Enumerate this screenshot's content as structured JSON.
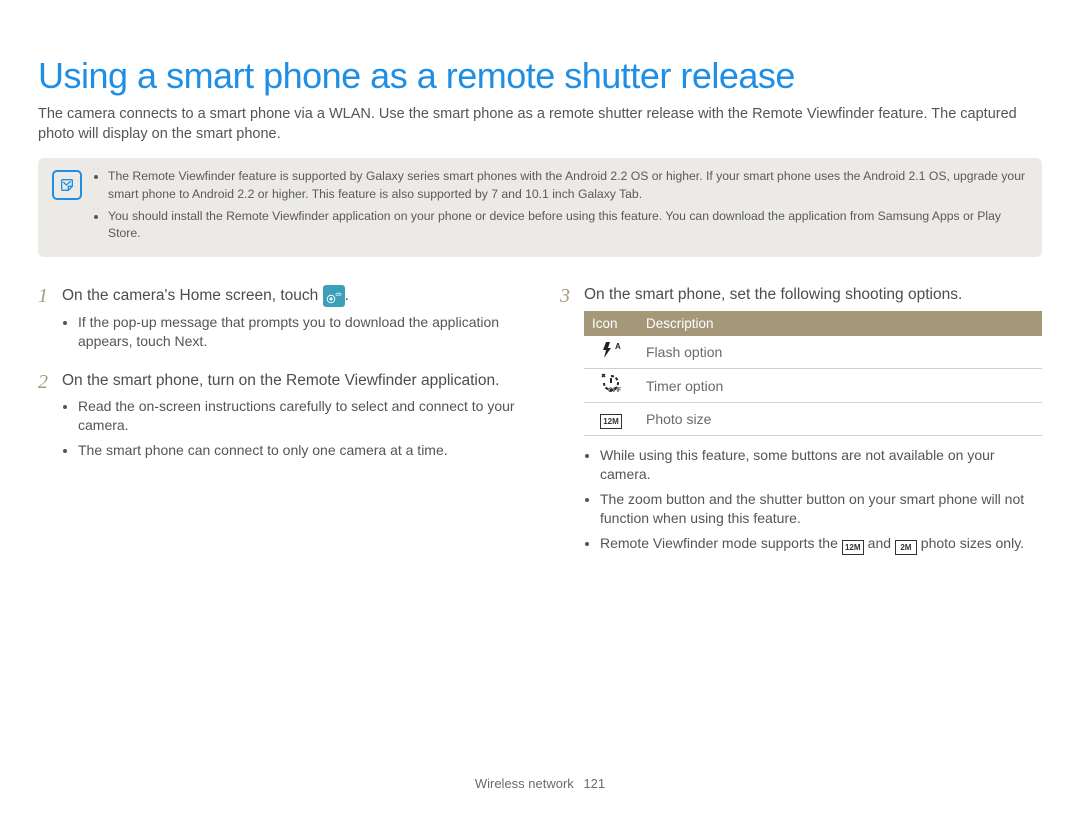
{
  "title": "Using a smart phone as a remote shutter release",
  "intro": "The camera connects to a smart phone via a WLAN. Use the smart phone as a remote shutter release with the Remote Viewfinder feature. The captured photo will display on the smart phone.",
  "notes": {
    "0": "The Remote Viewfinder feature is supported by Galaxy series smart phones with the Android 2.2 OS or higher. If your smart phone uses the Android 2.1 OS, upgrade your smart phone to Android 2.2 or higher. This feature is also supported by 7 and 10.1 inch Galaxy Tab.",
    "1": "You should install the Remote Viewfinder application on your phone or device before using this feature. You can download the application from Samsung Apps or Play Store."
  },
  "steps": {
    "s1": {
      "num": "1",
      "text_a": "On the camera's Home screen, touch ",
      "text_b": ".",
      "sub": {
        "0a": "If the pop-up message that prompts you to download the application appears, touch ",
        "0bold": "Next",
        "0b": "."
      }
    },
    "s2": {
      "num": "2",
      "text": "On the smart phone, turn on the Remote Viewfinder application.",
      "sub": {
        "0": "Read the on-screen instructions carefully to select and connect to your camera.",
        "1": "The smart phone can connect to only one camera at a time."
      }
    },
    "s3": {
      "num": "3",
      "text": "On the smart phone, set the following shooting options.",
      "table": {
        "h_icon": "Icon",
        "h_desc": "Description",
        "r0": {
          "desc": "Flash option"
        },
        "r1": {
          "desc": "Timer option"
        },
        "r2": {
          "desc": "Photo size",
          "size": "12M"
        }
      },
      "sub": {
        "0": "While using this feature, some buttons are not available on your camera.",
        "1": "The zoom button and the shutter button on your smart phone will not function when using this feature.",
        "2a": "Remote Viewfinder mode supports the ",
        "2size1": "12M",
        "2mid": " and ",
        "2size2": "2M",
        "2b": " photo sizes only."
      }
    }
  },
  "footer": {
    "section": "Wireless network",
    "page": "121"
  }
}
